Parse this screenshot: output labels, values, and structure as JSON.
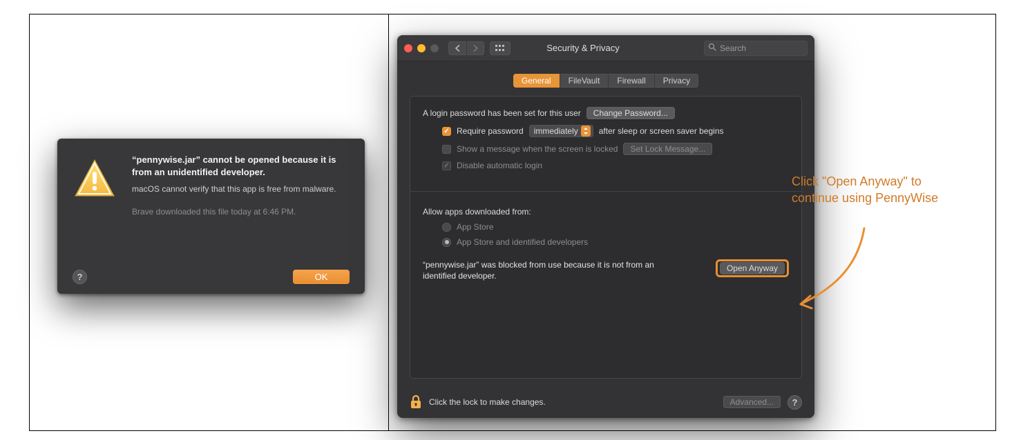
{
  "alert": {
    "title": "“pennywise.jar” cannot be opened because it is from an unidentified developer.",
    "subtitle": "macOS cannot verify that this app is free from malware.",
    "meta": "Brave downloaded this file today at 6:46 PM.",
    "help": "?",
    "ok": "OK"
  },
  "pref": {
    "window_title": "Security & Privacy",
    "search_placeholder": "Search",
    "tabs": {
      "general": "General",
      "filevault": "FileVault",
      "firewall": "Firewall",
      "privacy": "Privacy"
    },
    "login_pw_text": "A login password has been set for this user",
    "change_password": "Change Password...",
    "require_pw_label": "Require password",
    "require_pw_select": "immediately",
    "after_sleep": "after sleep or screen saver begins",
    "show_message": "Show a message when the screen is locked",
    "set_lock_msg": "Set Lock Message...",
    "disable_auto_login": "Disable automatic login",
    "allow_apps_from": "Allow apps downloaded from:",
    "radio_appstore": "App Store",
    "radio_identified": "App Store and identified developers",
    "blocked_msg": "“pennywise.jar” was blocked from use because it is not from an identified developer.",
    "open_anyway": "Open Anyway",
    "lock_text": "Click the lock to make changes.",
    "advanced": "Advanced...",
    "footer_help": "?"
  },
  "annotation": {
    "text": "Click \"Open Anyway\" to continue using PennyWise"
  }
}
